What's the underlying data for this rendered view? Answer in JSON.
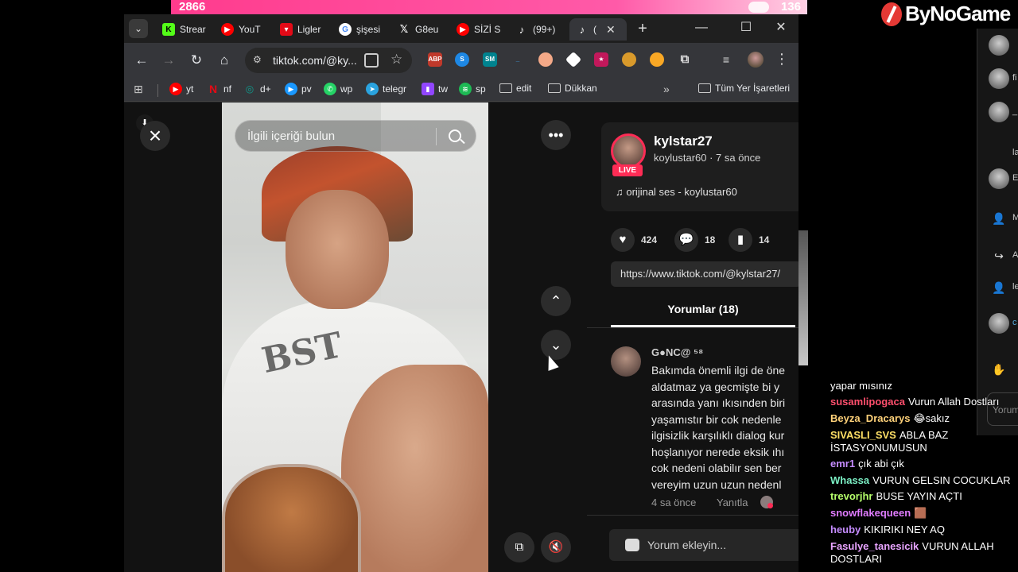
{
  "overlay": {
    "left_count": "2866",
    "right_count": "136",
    "brand": "ByNoGame"
  },
  "tabs": [
    {
      "label": "Strear",
      "icon": "kick-icon",
      "color": "#53fc18"
    },
    {
      "label": "YouT",
      "icon": "youtube-icon",
      "color": "#ff0000"
    },
    {
      "label": "Ligler",
      "icon": "shield-icon",
      "color": "#e30a17"
    },
    {
      "label": "şişesi",
      "icon": "google-icon",
      "color": "#4285f4"
    },
    {
      "label": "G8eu",
      "icon": "x-icon",
      "color": "#000000"
    },
    {
      "label": "SİZİ S",
      "icon": "youtube-icon",
      "color": "#ff0000"
    },
    {
      "label": "(99+)",
      "icon": "tiktok-icon",
      "color": "#000000"
    },
    {
      "label": "(",
      "icon": "tiktok-icon",
      "color": "#000000"
    }
  ],
  "address": {
    "url": "tiktok.com/@ky..."
  },
  "bookmarks": [
    {
      "label": "yt",
      "color": "#ff0000"
    },
    {
      "label": "nf",
      "color": "#e50914"
    },
    {
      "label": "d+",
      "color": "#0e9c8e"
    },
    {
      "label": "pv",
      "color": "#1a98ff"
    },
    {
      "label": "wp",
      "color": "#25d366"
    },
    {
      "label": "telegr",
      "color": "#2aa3df"
    },
    {
      "label": "tw",
      "color": "#9146ff"
    },
    {
      "label": "sp",
      "color": "#1db954"
    },
    {
      "label": "edit",
      "color": ""
    },
    {
      "label": "Dükkan",
      "color": ""
    }
  ],
  "bookmarks_all": "Tüm Yer İşaretleri",
  "video": {
    "search_placeholder": "İlgili içeriği bulun"
  },
  "post": {
    "username": "kylstar27",
    "live": "LIVE",
    "subline": "koylustar60 · 7 sa önce",
    "music": "orijinal ses - koylustar60",
    "likes": "424",
    "comments": "18",
    "saves": "14",
    "link": "https://www.tiktok.com/@kylstar27/"
  },
  "comments_tab": "Yorumlar (18)",
  "comment": {
    "user": "G●NC@ ⁵⁸",
    "lines": [
      "Bakımda önemli ilgi de öne",
      "aldatmaz ya gecmişte bi y",
      "arasında yanı ıkısınden biri",
      "yaşamıstır bir cok nedenle",
      "ilgisizlik karşılıklı dialog kur",
      "hoşlanıyor nerede eksik ıhı",
      "cok nedeni olabilır sen ber",
      "vereyim uzun uzun nedenl"
    ],
    "time": "4 sa önce",
    "reply": "Yanıtla"
  },
  "add_comment": "Yorum ekleyin...",
  "chat": [
    {
      "name": "",
      "color": "#ffffff",
      "text": "yapar mısınız"
    },
    {
      "name": "susamlipogaca",
      "color": "#ff4f6d",
      "text": "Vurun Allah Dostları"
    },
    {
      "name": "Beyza_Dracarys",
      "color": "#ffd27a",
      "text": "😂sakız"
    },
    {
      "name": "SIVASLI_SVS",
      "color": "#ffe066",
      "text": "ABLA BAZ İSTASYONUMUSUN"
    },
    {
      "name": "emr1",
      "color": "#c58cff",
      "text": "çık abi çık"
    },
    {
      "name": "Whassa",
      "color": "#7cf0c5",
      "text": "VURUN GELSIN COCUKLAR"
    },
    {
      "name": "trevorjhr",
      "color": "#b6ff6b",
      "text": "BUSE YAYIN AÇTI"
    },
    {
      "name": "snowflakequeen",
      "color": "#e07cff",
      "text": "🟫"
    },
    {
      "name": "heuby",
      "color": "#c58cff",
      "text": "KIKIRIKI NEY AQ"
    },
    {
      "name": "Fasulye_tanesicik",
      "color": "#e8a4ff",
      "text": "VURUN ALLAH DOSTLARI"
    }
  ],
  "right_panel": {
    "items": [
      "fi",
      "_",
      "la",
      "E",
      "M",
      "A",
      "le",
      "c"
    ],
    "input": "Yorum"
  }
}
